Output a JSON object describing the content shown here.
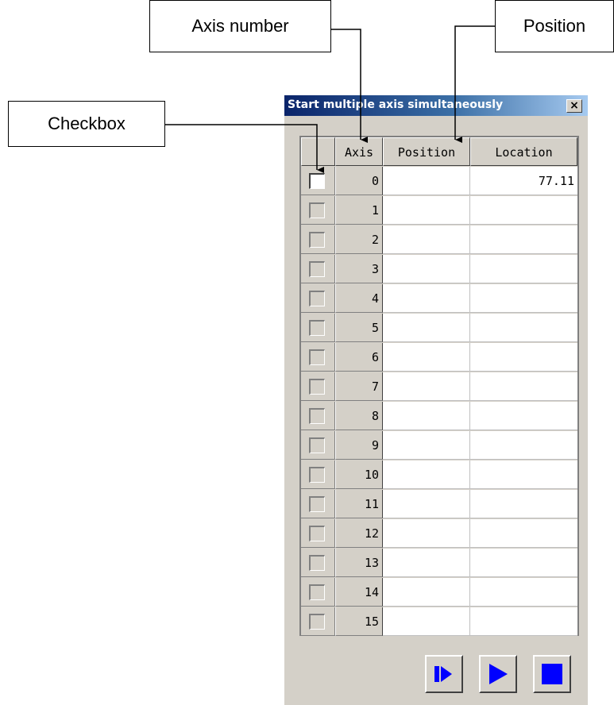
{
  "annotations": {
    "axis_number": "Axis number",
    "position": "Position",
    "checkbox": "Checkbox"
  },
  "dialog": {
    "title": "Start multiple axis simultaneously",
    "close_symbol": "×"
  },
  "table": {
    "headers": [
      "",
      "Axis",
      "Position",
      "Location"
    ],
    "rows": [
      {
        "checked_state": "active",
        "axis": "0",
        "position": "",
        "location": "77.11"
      },
      {
        "checked_state": "inactive",
        "axis": "1",
        "position": "",
        "location": ""
      },
      {
        "checked_state": "inactive",
        "axis": "2",
        "position": "",
        "location": ""
      },
      {
        "checked_state": "inactive",
        "axis": "3",
        "position": "",
        "location": ""
      },
      {
        "checked_state": "inactive",
        "axis": "4",
        "position": "",
        "location": ""
      },
      {
        "checked_state": "inactive",
        "axis": "5",
        "position": "",
        "location": ""
      },
      {
        "checked_state": "inactive",
        "axis": "6",
        "position": "",
        "location": ""
      },
      {
        "checked_state": "inactive",
        "axis": "7",
        "position": "",
        "location": ""
      },
      {
        "checked_state": "inactive",
        "axis": "8",
        "position": "",
        "location": ""
      },
      {
        "checked_state": "inactive",
        "axis": "9",
        "position": "",
        "location": ""
      },
      {
        "checked_state": "inactive",
        "axis": "10",
        "position": "",
        "location": ""
      },
      {
        "checked_state": "inactive",
        "axis": "11",
        "position": "",
        "location": ""
      },
      {
        "checked_state": "inactive",
        "axis": "12",
        "position": "",
        "location": ""
      },
      {
        "checked_state": "inactive",
        "axis": "13",
        "position": "",
        "location": ""
      },
      {
        "checked_state": "inactive",
        "axis": "14",
        "position": "",
        "location": ""
      },
      {
        "checked_state": "inactive",
        "axis": "15",
        "position": "",
        "location": ""
      }
    ]
  },
  "toolbar": {
    "buttons": [
      {
        "icon": "step-forward-icon"
      },
      {
        "icon": "play-icon"
      },
      {
        "icon": "stop-icon"
      }
    ],
    "icon_color": "#0000ff"
  },
  "colors": {
    "dialog_bg": "#d4d0c8",
    "title_start": "#0a246a",
    "title_end": "#a6caf0"
  }
}
